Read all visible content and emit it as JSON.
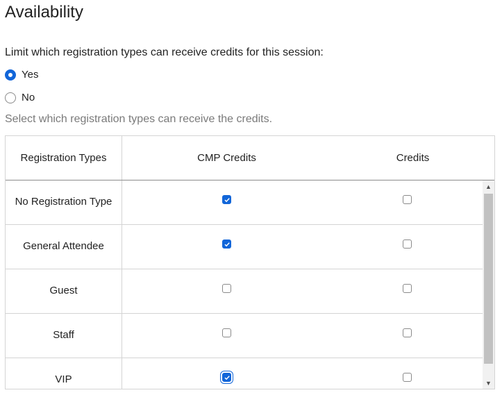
{
  "section": {
    "title": "Availability"
  },
  "limit_question": {
    "label": "Limit which registration types can receive credits for this session:",
    "options": [
      {
        "label": "Yes",
        "checked": true
      },
      {
        "label": "No",
        "checked": false
      }
    ]
  },
  "hint": "Select which registration types can receive the credits.",
  "table": {
    "headers": [
      "Registration Types",
      "CMP Credits",
      "Credits"
    ],
    "rows": [
      {
        "type": "No Registration Type",
        "cmp": true,
        "credits": false
      },
      {
        "type": "General Attendee",
        "cmp": true,
        "credits": false
      },
      {
        "type": "Guest",
        "cmp": false,
        "credits": false
      },
      {
        "type": "Staff",
        "cmp": false,
        "credits": false
      },
      {
        "type": "VIP",
        "cmp": true,
        "credits": false
      }
    ]
  },
  "icons": {
    "scroll_up": "chevron-up-icon",
    "scroll_down": "chevron-down-icon",
    "check": "checkmark-icon"
  },
  "colors": {
    "accent": "#1266d9",
    "hint_text": "#7a7a7a",
    "border": "#d4d4d4"
  }
}
